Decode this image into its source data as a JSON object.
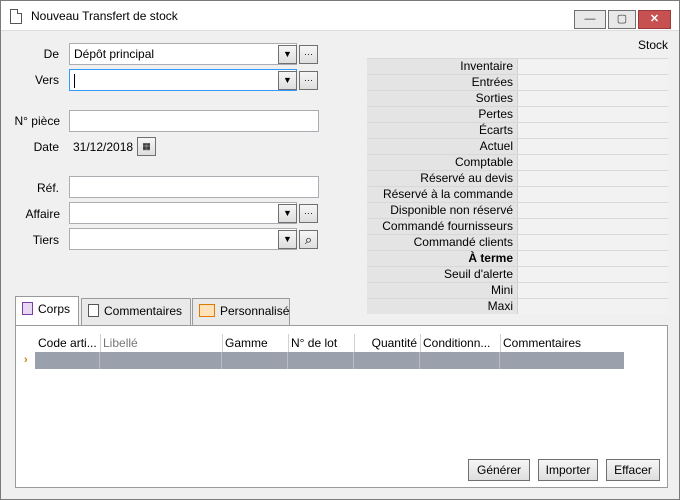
{
  "window": {
    "title": "Nouveau Transfert de stock",
    "minimize_glyph": "—",
    "maximize_glyph": "▢",
    "close_glyph": "✕"
  },
  "form": {
    "de_label": "De",
    "de_value": "Dépôt principal",
    "vers_label": "Vers",
    "vers_value": "",
    "piece_label": "N° pièce",
    "piece_value": "",
    "date_label": "Date",
    "date_value": "31/12/2018",
    "ref_label": "Réf.",
    "ref_value": "",
    "affaire_label": "Affaire",
    "affaire_value": "",
    "tiers_label": "Tiers",
    "tiers_value": "",
    "dropdown_glyph": "▼",
    "more_glyph": "···",
    "search_glyph": "⌕",
    "calendar_glyph": "▦"
  },
  "stock": {
    "title": "Stock",
    "rows": [
      {
        "label": "Inventaire",
        "bold": false
      },
      {
        "label": "Entrées",
        "bold": false
      },
      {
        "label": "Sorties",
        "bold": false
      },
      {
        "label": "Pertes",
        "bold": false
      },
      {
        "label": "Écarts",
        "bold": false
      },
      {
        "label": "Actuel",
        "bold": false
      },
      {
        "label": "Comptable",
        "bold": false
      },
      {
        "label": "Réservé au devis",
        "bold": false
      },
      {
        "label": "Réservé à la commande",
        "bold": false
      },
      {
        "label": "Disponible non réservé",
        "bold": false
      },
      {
        "label": "Commandé fournisseurs",
        "bold": false
      },
      {
        "label": "Commandé clients",
        "bold": false
      },
      {
        "label": "À terme",
        "bold": true
      },
      {
        "label": "Seuil d'alerte",
        "bold": false
      },
      {
        "label": "Mini",
        "bold": false
      },
      {
        "label": "Maxi",
        "bold": false
      }
    ]
  },
  "tabs": [
    {
      "label": "Corps",
      "active": true
    },
    {
      "label": "Commentaires",
      "active": false
    },
    {
      "label": "Personnalisé",
      "active": false
    }
  ],
  "grid": {
    "columns": [
      "Code arti...",
      "Libellé",
      "Gamme",
      "N° de lot",
      "Quantité",
      "Conditionn...",
      "Commentaires"
    ],
    "row_marker": "›"
  },
  "buttons": {
    "generer": "Générer",
    "importer": "Importer",
    "effacer": "Effacer"
  },
  "colors": {
    "selected_row": "#9aa0ac",
    "focus_border": "#3399ff",
    "close_button": "#c75050"
  }
}
